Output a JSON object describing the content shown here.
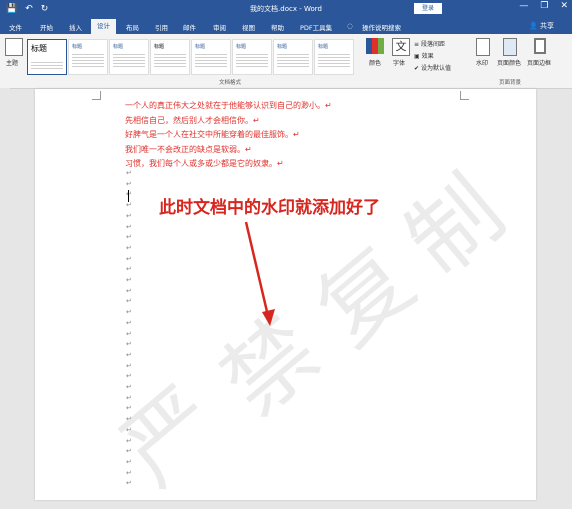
{
  "titlebar": {
    "doc_title": "我的文档.docx - Word",
    "login": "登录",
    "save_glyph": "💾",
    "undo_glyph": "↶",
    "redo_glyph": "↻",
    "minimize": "—",
    "restore": "❐",
    "close": "✕"
  },
  "tabs": [
    "文件",
    "开始",
    "插入",
    "设计",
    "布局",
    "引用",
    "邮件",
    "审阅",
    "视图",
    "帮助",
    "PDF工具集",
    "操作说明搜索"
  ],
  "active_tab": "设计",
  "share": "共享",
  "ribbon": {
    "theme_label": "主题",
    "style_items": [
      "标题",
      "标题",
      "标题",
      "标题",
      "标题",
      "标题",
      "标题",
      "标题"
    ],
    "title_sample": "标题",
    "heading_sample": "标题 1",
    "group_doc_format": "文档格式",
    "colors_label": "颜色",
    "fonts_label": "字体",
    "para_spacing": "段落间距",
    "effects": "效果",
    "set_default": "设为默认值",
    "watermark": "水印",
    "page_color": "页面颜色",
    "page_border": "页面边框",
    "group_page_bg": "页面背景"
  },
  "document": {
    "lines": [
      "一个人的真正伟大之处就在于他能够认识到自己的渺小。↵",
      "先相信自己，然后别人才会相信你。↵",
      "好脾气是一个人在社交中所能穿着的最佳服饰。↵",
      "我们唯一不会改正的缺点是软弱。↵",
      "习惯，我们每个人或多或少都是它的奴隶。↵"
    ],
    "para_mark": "↵",
    "callout": "此时文档中的水印就添加好了",
    "watermark_chars": [
      "严",
      "禁",
      "复",
      "制"
    ]
  },
  "colors": {
    "title_bar": "#2b579a",
    "content_text": "#e0302c",
    "arrow": "#d7261e"
  }
}
